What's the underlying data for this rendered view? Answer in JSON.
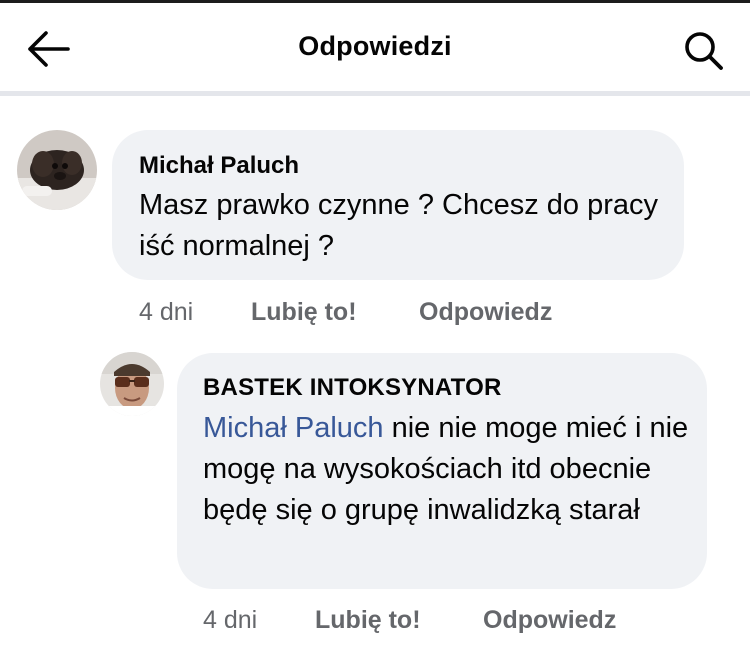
{
  "header": {
    "title": "Odpowiedzi",
    "back_icon": "arrow-left-icon",
    "search_icon": "search-icon"
  },
  "comments": [
    {
      "author": "Michał Paluch",
      "text": "Masz prawko czynne ? Chcesz do pracy iść normalnej ?",
      "time": "4 dni",
      "like_label": "Lubię to!",
      "reply_label": "Odpowiedz"
    },
    {
      "author": "BASTEK INTOKSYNATOR",
      "mention": "Michał Paluch",
      "text": " nie nie moge mieć i nie mogę na wysokościach itd obecnie będę się o grupę inwalidzką starał",
      "time": "4 dni",
      "like_label": "Lubię to!",
      "reply_label": "Odpowiedz"
    }
  ],
  "colors": {
    "bubble": "#f0f2f5",
    "mention": "#385898",
    "meta": "#65676b",
    "divider": "#e4e6eb"
  }
}
